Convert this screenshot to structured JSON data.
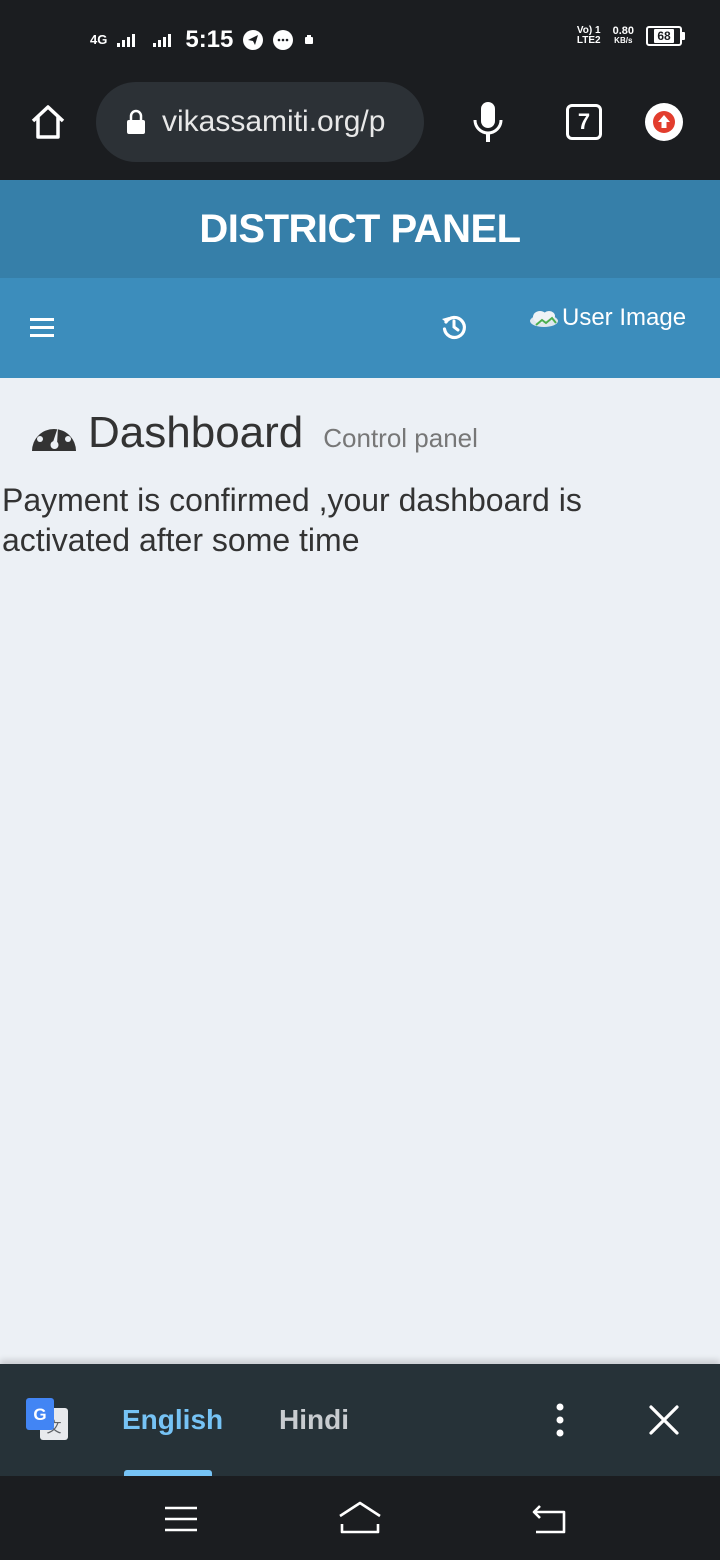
{
  "status_bar": {
    "network": "4G",
    "time": "5:15",
    "volte": "Vo) 1",
    "lte": "LTE2",
    "speed_value": "0.80",
    "speed_unit": "KB/s",
    "battery": "68"
  },
  "browser": {
    "url": "vikassamiti.org/p",
    "tab_count": "7"
  },
  "header": {
    "title": "DISTRICT PANEL"
  },
  "navbar": {
    "user_image_alt": "User Image"
  },
  "content": {
    "title": "Dashboard",
    "subtitle": "Control panel",
    "message": "Payment is confirmed ,your dashboard is activated after some time"
  },
  "translate_bar": {
    "language_1": "English",
    "language_2": "Hindi",
    "active_language": "English"
  },
  "colors": {
    "header_dark": "#367fa9",
    "header_light": "#3c8dbc",
    "background": "#ecf0f5",
    "accent_blue": "#76c3f5"
  }
}
